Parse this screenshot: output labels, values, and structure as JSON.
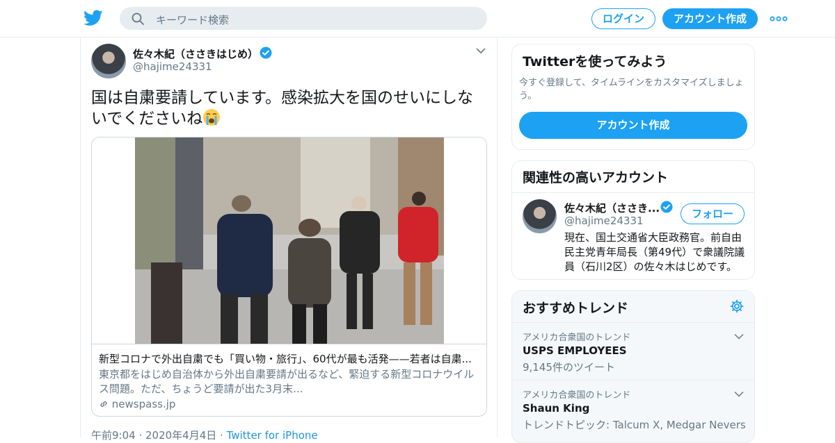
{
  "header": {
    "logo_icon": "twitter-bird-icon",
    "search_placeholder": "キーワード検索",
    "login_label": "ログイン",
    "signup_label": "アカウント作成",
    "more_icon": "more-dots-icon",
    "accent_color": "#1da1f2"
  },
  "tweet": {
    "author_name": "佐々木紀（ささきはじめ）",
    "author_handle": "@hajime24331",
    "text": "国は自粛要請しています。感染拡大を国のせいにしないでくださいね",
    "emoji": "loudly-crying-face",
    "card": {
      "title": "新型コロナで外出自粛でも「買い物・旅行」、60代が最も活発——若者は自粛...",
      "description": "東京都をはじめ自治体から外出自粛要請が出るなど、緊迫する新型コロナウイルス問題。ただ、ちょうど要請が出た3月末...",
      "domain": "newspass.jp"
    },
    "time": "午前9:04 · 2020年4月4日 · ",
    "source": "Twitter for iPhone"
  },
  "signup_panel": {
    "title": "Twitterを使ってみよう",
    "subtitle": "今すぐ登録して、タイムラインをカスタマイズしましょう。",
    "button": "アカウント作成"
  },
  "related": {
    "title": "関連性の高いアカウント",
    "name": "佐々木紀（ささき...",
    "handle": "@hajime24331",
    "follow_label": "フォロー",
    "bio": "現在、国土交通省大臣政務官。前自由民主党青年局長（第49代）で衆議院議員（石川2区）の佐々木はじめです。"
  },
  "trends": {
    "title": "おすすめトレンド",
    "items": [
      {
        "location": "アメリカ合衆国のトレンド",
        "name": "USPS EMPLOYEES",
        "count": "9,145件のツイート"
      },
      {
        "location": "アメリカ合衆国のトレンド",
        "name": "Shaun King",
        "count": "トレンドトピック: Talcum X, Medgar Nevers"
      }
    ]
  }
}
